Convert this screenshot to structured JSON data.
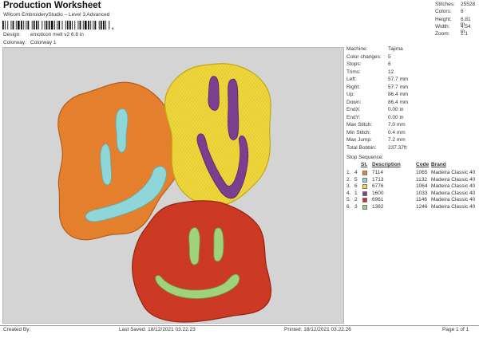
{
  "header": {
    "title": "Production Worksheet",
    "subtitle": "Wilcom EmbroideryStudio – Level 3 Advanced",
    "barcode_text": ","
  },
  "design_info": {
    "design_label": "Design:",
    "design_value": "emoticon melt v2 6.8 in",
    "colorway_label": "Colorway:",
    "colorway_value": "Colorway 1"
  },
  "stats": [
    {
      "label": "Stitches:",
      "value": "25528"
    },
    {
      "label": "Colors:",
      "value": "6"
    },
    {
      "label": "Height:",
      "value": "6.81 in"
    },
    {
      "label": "Width:",
      "value": "4.54 in"
    },
    {
      "label": "Zoom:",
      "value": "1:1"
    }
  ],
  "machine_info": [
    {
      "label": "Machine:",
      "value": "Tajima"
    },
    {
      "label": "Color changes:",
      "value": "5"
    },
    {
      "label": "Stops:",
      "value": "6"
    },
    {
      "label": "Trims:",
      "value": "12"
    },
    {
      "label": "Left:",
      "value": "57.7 mm"
    },
    {
      "label": "Right:",
      "value": "57.7 mm"
    },
    {
      "label": "Up:",
      "value": "86.4 mm"
    },
    {
      "label": "Down:",
      "value": "86.4 mm"
    },
    {
      "label": "EndX:",
      "value": "0.00 in"
    },
    {
      "label": "EndY:",
      "value": "0.00 in"
    },
    {
      "label": "Max Stitch:",
      "value": "7.0 mm"
    },
    {
      "label": "Min Stitch:",
      "value": "0.4 mm"
    },
    {
      "label": "Max Jump:",
      "value": "7.2 mm"
    },
    {
      "label": "Total Bobbin:",
      "value": "237.37ft"
    }
  ],
  "stop_sequence": {
    "title": "Stop Sequence:",
    "columns": {
      "st": "St.",
      "description": "Description",
      "code": "Code",
      "brand": "Brand"
    },
    "rows": [
      {
        "num": "1.",
        "st": "4",
        "color": "#e8822e",
        "description": "7114",
        "code": "1065",
        "brand": "Madeira Classic 40"
      },
      {
        "num": "2.",
        "st": "5",
        "color": "#8fd6d8",
        "description": "1713",
        "code": "1132",
        "brand": "Madeira Classic 40"
      },
      {
        "num": "3.",
        "st": "6",
        "color": "#f2dc3e",
        "description": "6776",
        "code": "1064",
        "brand": "Madeira Classic 40"
      },
      {
        "num": "4.",
        "st": "1",
        "color": "#7a3f8e",
        "description": "1600",
        "code": "1033",
        "brand": "Madeira Classic 40"
      },
      {
        "num": "5.",
        "st": "2",
        "color": "#d82a22",
        "description": "6961",
        "code": "1146",
        "brand": "Madeira Classic 40"
      },
      {
        "num": "6.",
        "st": "3",
        "color": "#9fd27a",
        "description": "1362",
        "code": "1246",
        "brand": "Madeira Classic 40"
      }
    ]
  },
  "footer": {
    "created_by": "Created By:",
    "last_saved": "Last Saved: 18/12/2021 03.22.23",
    "printed": "Printed: 18/12/2021 03.22.26",
    "page": "Page 1 of 1"
  },
  "colors": {
    "orange_face": "#e8822e",
    "yellow_face": "#efd63a",
    "red_face": "#cf3a25",
    "cyan_features": "#8fd6d8",
    "purple_features": "#7a3f8e",
    "green_features": "#9fd27a",
    "canvas": "#d4d4d4"
  }
}
